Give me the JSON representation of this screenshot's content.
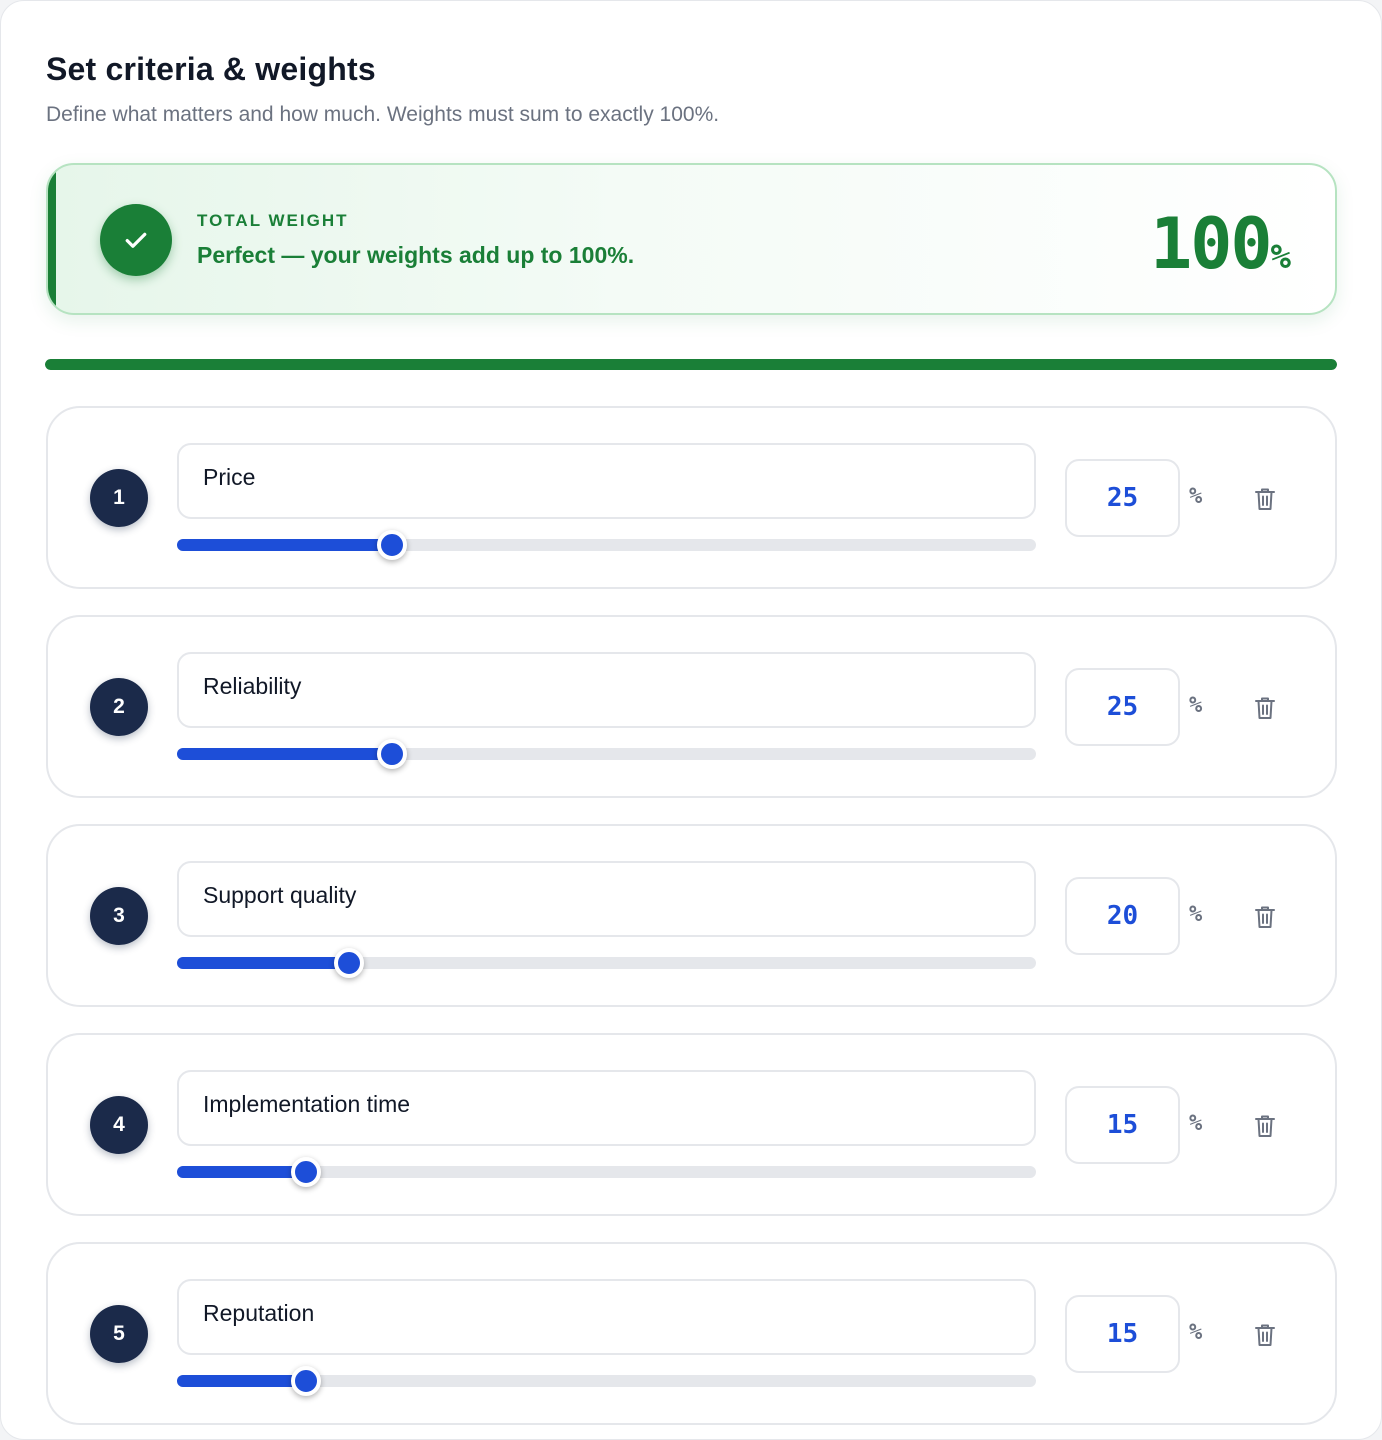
{
  "header": {
    "title": "Set criteria & weights",
    "subtitle": "Define what matters and how much. Weights must sum to exactly 100%."
  },
  "total": {
    "label": "TOTAL WEIGHT",
    "message": "Perfect — your weights add up to 100%.",
    "value": "100",
    "unit": "%",
    "progress": 100,
    "status_icon": "check-icon",
    "accent_color": "#1a7f37"
  },
  "criteria": [
    {
      "index": "1",
      "name": "Price",
      "weight": "25",
      "unit": "%",
      "slider_value": 25,
      "delete_icon": "trash-icon"
    },
    {
      "index": "2",
      "name": "Reliability",
      "weight": "25",
      "unit": "%",
      "slider_value": 25,
      "delete_icon": "trash-icon"
    },
    {
      "index": "3",
      "name": "Support quality",
      "weight": "20",
      "unit": "%",
      "slider_value": 20,
      "delete_icon": "trash-icon"
    },
    {
      "index": "4",
      "name": "Implementation time",
      "weight": "15",
      "unit": "%",
      "slider_value": 15,
      "delete_icon": "trash-icon"
    },
    {
      "index": "5",
      "name": "Reputation",
      "weight": "15",
      "unit": "%",
      "slider_value": 15,
      "delete_icon": "trash-icon"
    }
  ],
  "colors": {
    "slider_fill": "#1d4ed8",
    "badge_bg": "#1b2a4a"
  }
}
